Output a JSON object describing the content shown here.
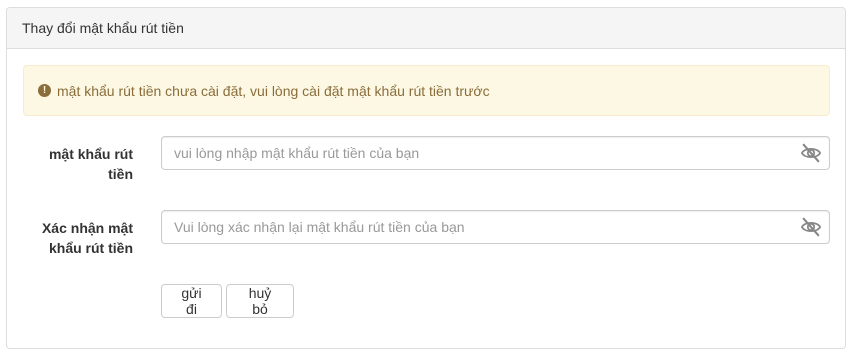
{
  "panel": {
    "title": "Thay đổi mật khẩu rút tiền"
  },
  "alert": {
    "icon": "exclamation-circle-icon",
    "message": "mật khẩu rút tiền chưa cài đặt, vui lòng cài đặt mật khẩu rút tiền trước",
    "color": "#8a6d3b",
    "background": "#fcf8e3"
  },
  "form": {
    "password": {
      "label": "mật khẩu rút tiền",
      "placeholder": "vui lòng nhập mật khẩu rút tiền của bạn",
      "value": "",
      "icon": "eye-slash-icon"
    },
    "confirm": {
      "label": "Xác nhận mật khẩu rút tiền",
      "placeholder": "Vui lòng xác nhận lại mật khẩu rút tiền của bạn",
      "value": "",
      "icon": "eye-slash-icon"
    }
  },
  "actions": {
    "submit_label": "gửi đi",
    "cancel_label": "huỷ bỏ"
  }
}
